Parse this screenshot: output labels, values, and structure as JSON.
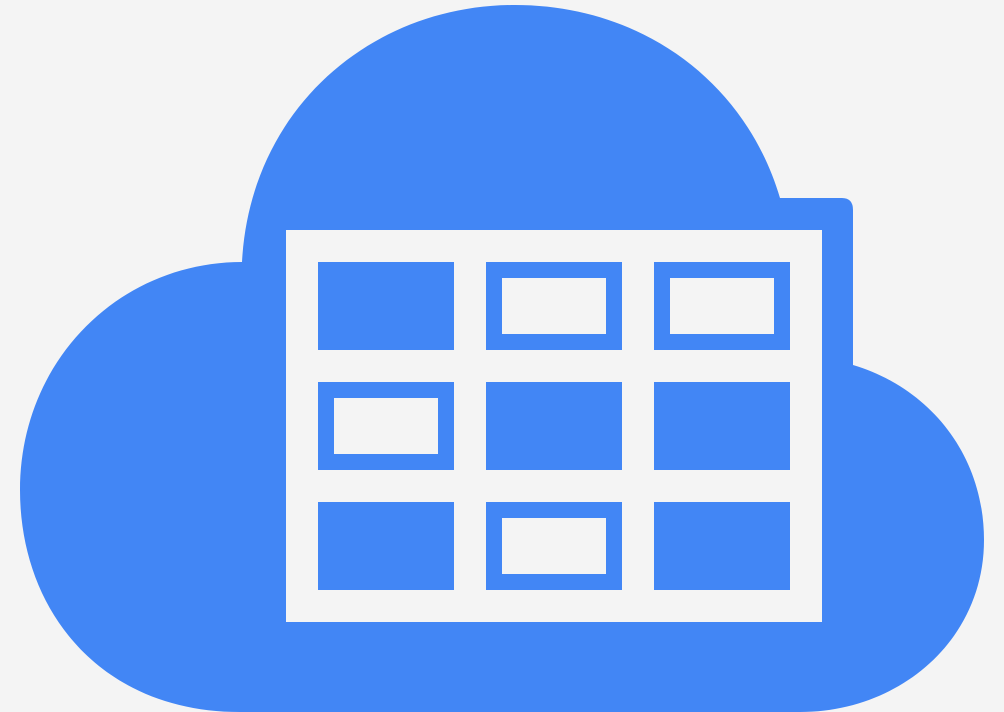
{
  "icon": {
    "name": "cloud-table-icon",
    "colors": {
      "brand": "#4286f5",
      "background": "#f4f4f4"
    },
    "grid": {
      "rows": 3,
      "columns": 3,
      "cells": [
        [
          "filled",
          "outlined",
          "outlined"
        ],
        [
          "outlined",
          "filled",
          "filled"
        ],
        [
          "filled",
          "outlined",
          "filled"
        ]
      ]
    }
  }
}
